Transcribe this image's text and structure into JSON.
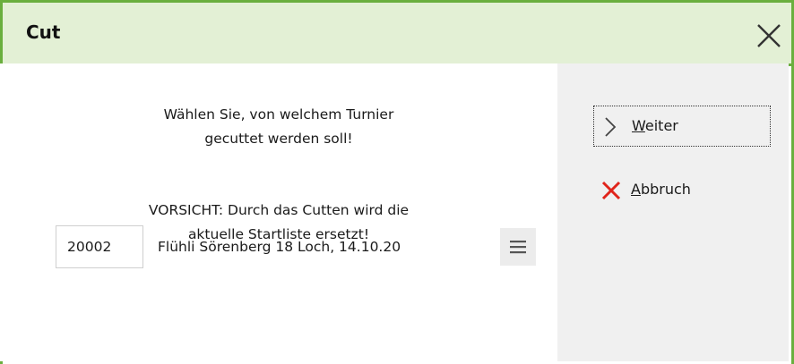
{
  "dialog": {
    "title": "Cut",
    "accent_color": "#6aaf3e",
    "header_bg": "#e3f0d5"
  },
  "message": {
    "line1": "Wählen Sie, von welchem Turnier",
    "line2": "gecuttet werden soll!",
    "line3": "VORSICHT: Durch das Cutten wird die",
    "line4": "aktuelle Startliste ersetzt!"
  },
  "tournament": {
    "number": "20002",
    "name": "Flühli Sörenberg 18 Loch, 14.10.20",
    "menu_icon": "hamburger-menu-icon"
  },
  "actions": {
    "next": {
      "mnemonic": "W",
      "rest": "eiter",
      "icon": "chevron-right-icon"
    },
    "cancel": {
      "mnemonic": "A",
      "rest": "bbruch",
      "icon": "close-x-icon",
      "icon_color": "#e0241b"
    }
  }
}
